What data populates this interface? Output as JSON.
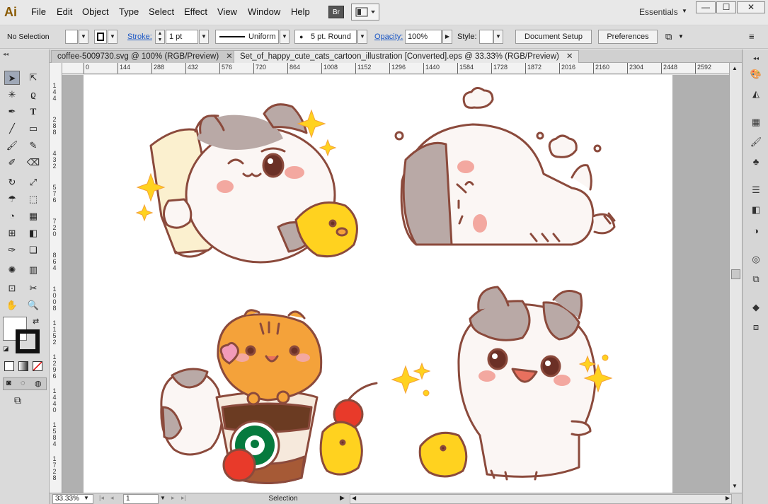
{
  "app": {
    "logo": "Ai"
  },
  "menu": {
    "items": [
      "File",
      "Edit",
      "Object",
      "Type",
      "Select",
      "Effect",
      "View",
      "Window",
      "Help"
    ],
    "bridge_label": "Br",
    "workspace": "Essentials",
    "window_controls": {
      "minimize": "—",
      "maximize": "☐",
      "close": "✕"
    }
  },
  "control": {
    "selection_label": "No Selection",
    "stroke_label": "Stroke:",
    "stroke_weight": "1 pt",
    "profile": "Uniform",
    "brush": "5 pt. Round",
    "opacity_label": "Opacity:",
    "opacity": "100%",
    "style_label": "Style:",
    "document_setup": "Document Setup",
    "preferences": "Preferences"
  },
  "tabs": [
    {
      "label": "coffee-5009730.svg @ 100% (RGB/Preview)",
      "close": "✕"
    },
    {
      "label": "Set_of_happy_cute_cats_cartoon_illustration [Converted].eps @ 33.33% (RGB/Preview)",
      "close": "✕"
    }
  ],
  "ruler": {
    "h_labels": [
      "0",
      "144",
      "288",
      "432",
      "576",
      "720",
      "864",
      "1008",
      "1152",
      "1296",
      "1440",
      "1584",
      "1728",
      "1872",
      "2016",
      "2160",
      "2304",
      "2448",
      "2592"
    ],
    "v_labels": [
      "1 4 4",
      "2 8 8",
      "4 3 2",
      "5 7 6",
      "7 2 0",
      "8 6 4",
      "1 0 0 8",
      "1 1 5 2",
      "1 2 9 6",
      "1 4 4 0",
      "1 5 8 4",
      "1 7 2 8"
    ]
  },
  "status": {
    "zoom": "33.33%",
    "page": "1",
    "tool": "Selection"
  },
  "colors": {
    "outline": "#8b4a3c",
    "fur_gray": "#b9a9a6",
    "fur_white": "#fbf6f4",
    "blush": "#f3a8a0",
    "orange": "#f4a23a",
    "yellow": "#ffd21f",
    "cherry": "#e83a2a",
    "starbucks_green": "#067a3e",
    "cup": "#f6e9dc",
    "coffee": "#6b3b22"
  }
}
